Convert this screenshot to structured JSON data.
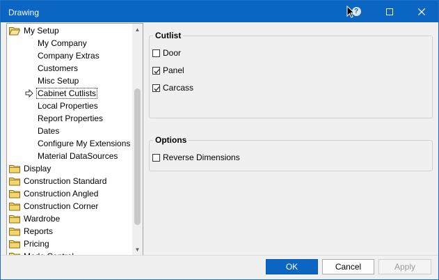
{
  "window": {
    "title": "Drawing",
    "help_glyph": "?",
    "maximize_glyph": "☐",
    "close_glyph": "✕"
  },
  "tree": {
    "items": [
      {
        "label": "My Setup",
        "level": 0,
        "folder": true,
        "expanded": true
      },
      {
        "label": "My Company",
        "level": 1
      },
      {
        "label": "Company Extras",
        "level": 1
      },
      {
        "label": "Customers",
        "level": 1
      },
      {
        "label": "Misc Setup",
        "level": 1
      },
      {
        "label": "Cabinet Cutlists",
        "level": 1,
        "selected": true
      },
      {
        "label": "Local Properties",
        "level": 1
      },
      {
        "label": "Report Properties",
        "level": 1
      },
      {
        "label": "Dates",
        "level": 1
      },
      {
        "label": "Configure My Extensions",
        "level": 1
      },
      {
        "label": "Material DataSources",
        "level": 1
      },
      {
        "label": "Display",
        "level": 0,
        "folder": true
      },
      {
        "label": "Construction Standard",
        "level": 0,
        "folder": true
      },
      {
        "label": "Construction Angled",
        "level": 0,
        "folder": true
      },
      {
        "label": "Construction Corner",
        "level": 0,
        "folder": true
      },
      {
        "label": "Wardrobe",
        "level": 0,
        "folder": true
      },
      {
        "label": "Reports",
        "level": 0,
        "folder": true
      },
      {
        "label": "Pricing",
        "level": 0,
        "folder": true
      },
      {
        "label": "Mode Control",
        "level": 0,
        "folder": true
      }
    ]
  },
  "cutlist": {
    "title": "Cutlist",
    "options": [
      {
        "label": "Door",
        "checked": false
      },
      {
        "label": "Panel",
        "checked": true
      },
      {
        "label": "Carcass",
        "checked": true
      }
    ]
  },
  "options": {
    "title": "Options",
    "reverse_dimensions": {
      "label": "Reverse Dimensions",
      "checked": false
    }
  },
  "buttons": {
    "ok": "OK",
    "cancel": "Cancel",
    "apply": "Apply"
  },
  "colors": {
    "titlebar": "#0b66c3",
    "folder": "#f2d66b"
  }
}
